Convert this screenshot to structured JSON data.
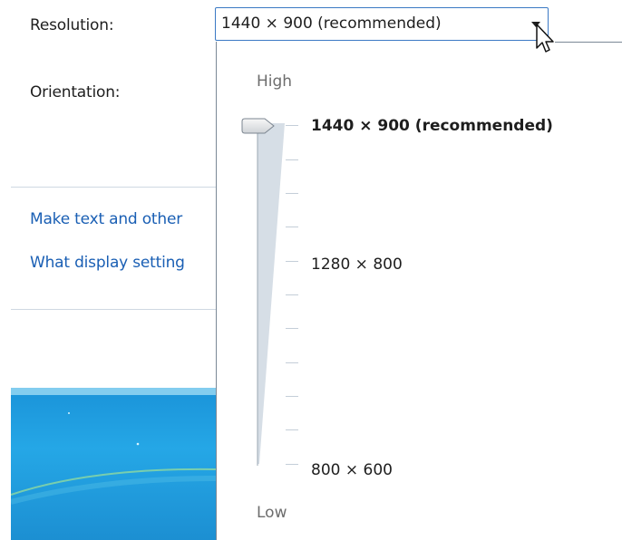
{
  "settings": {
    "resolution_label": "Resolution:",
    "orientation_label": "Orientation:",
    "link_text_size": "Make text and other",
    "link_display_settings": "What display setting"
  },
  "dropdown": {
    "selected_value": "1440 × 900 (recommended)",
    "high_label": "High",
    "low_label": "Low",
    "options": [
      "1440 × 900 (recommended)",
      "1280 × 800",
      "800 × 600"
    ],
    "slider_value": "1440 × 900 (recommended)"
  },
  "colors": {
    "link": "#1a5fb4",
    "select_border": "#3b79c4"
  }
}
